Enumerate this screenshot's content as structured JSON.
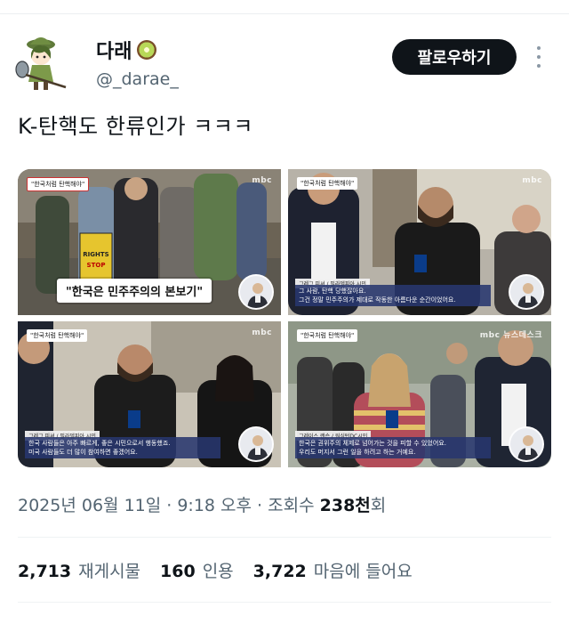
{
  "user": {
    "display_name": "다래",
    "handle": "@_darae_",
    "follow_label": "팔로우하기"
  },
  "tweet": {
    "text": "K-탄핵도 한류인가 ㅋㅋㅋ"
  },
  "media": [
    {
      "tag": "\"한국처럼 탄핵해야\"",
      "logo": "mbc",
      "caption": "\"한국은 민주주의의 본보기\"",
      "icons": [
        "signer-icon"
      ]
    },
    {
      "tag": "\"한국처럼 탄핵해야\"",
      "logo": "mbc",
      "name_strip": "그레그 피셔 / 필라델피아 시민",
      "subtitle": [
        "그 사람, 탄핵 당했잖아요.",
        "그건 정말 민주주의가 제대로 작동한 아름다운 순간이었어요."
      ],
      "icons": [
        "signer-icon"
      ]
    },
    {
      "tag": "\"한국처럼 탄핵해야\"",
      "logo": "mbc",
      "name_strip": "그레그 피셔 / 필라델피아 시민",
      "subtitle": [
        "한국 사람들은 아주 빠르게, 좋은 시민으로서 행동했죠.",
        "미국 사람들도 더 많이 참여하면 좋겠어요."
      ],
      "icons": [
        "signer-icon"
      ]
    },
    {
      "tag": "\"한국처럼 탄핵해야\"",
      "logo": "mbc 뉴스데스크",
      "name_strip": "그레이스 랜슨 / 워싱턴DC시민",
      "subtitle": [
        "한국은 권위주의 체제로 넘어가는 것을 피할 수 있었어요.",
        "우리도 머지서 그런 일을 하려고 하는 거예요."
      ],
      "icons": [
        "signer-icon"
      ]
    }
  ],
  "meta": {
    "datetime": "2025년 06월 11일 · 9:18 오후 · 조회수",
    "views": "238천",
    "views_suffix": "회"
  },
  "stats": {
    "retweets_count": "2,713",
    "retweets_label": "재게시물",
    "quotes_count": "160",
    "quotes_label": "인용",
    "likes_count": "3,722",
    "likes_label": "마음에 들어요"
  }
}
